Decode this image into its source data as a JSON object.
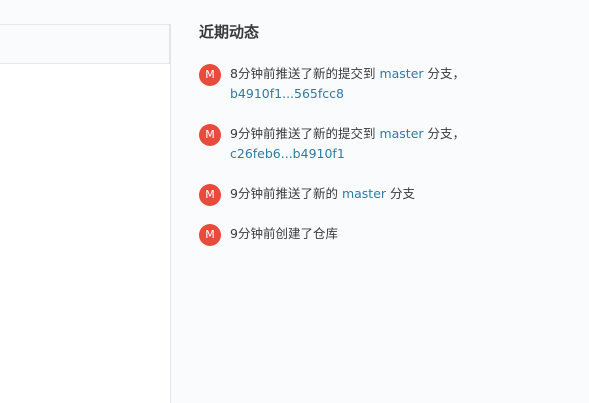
{
  "recent_activity": {
    "title": "近期动态",
    "items": [
      {
        "avatar": "M",
        "prefix": "8分钟前推送了新的提交到 ",
        "branch": "master",
        "middle": " 分支，",
        "commit_range": "b4910f1...565fcc8"
      },
      {
        "avatar": "M",
        "prefix": "9分钟前推送了新的提交到 ",
        "branch": "master",
        "middle": " 分支，",
        "commit_range": "c26feb6...b4910f1"
      },
      {
        "avatar": "M",
        "prefix": "9分钟前推送了新的 ",
        "branch": "master",
        "suffix": " 分支"
      },
      {
        "avatar": "M",
        "text": "9分钟前创建了仓库"
      }
    ]
  },
  "colors": {
    "avatar_bg": "#e84b3c",
    "link": "#2f7ba6",
    "background": "#fafbfc"
  }
}
